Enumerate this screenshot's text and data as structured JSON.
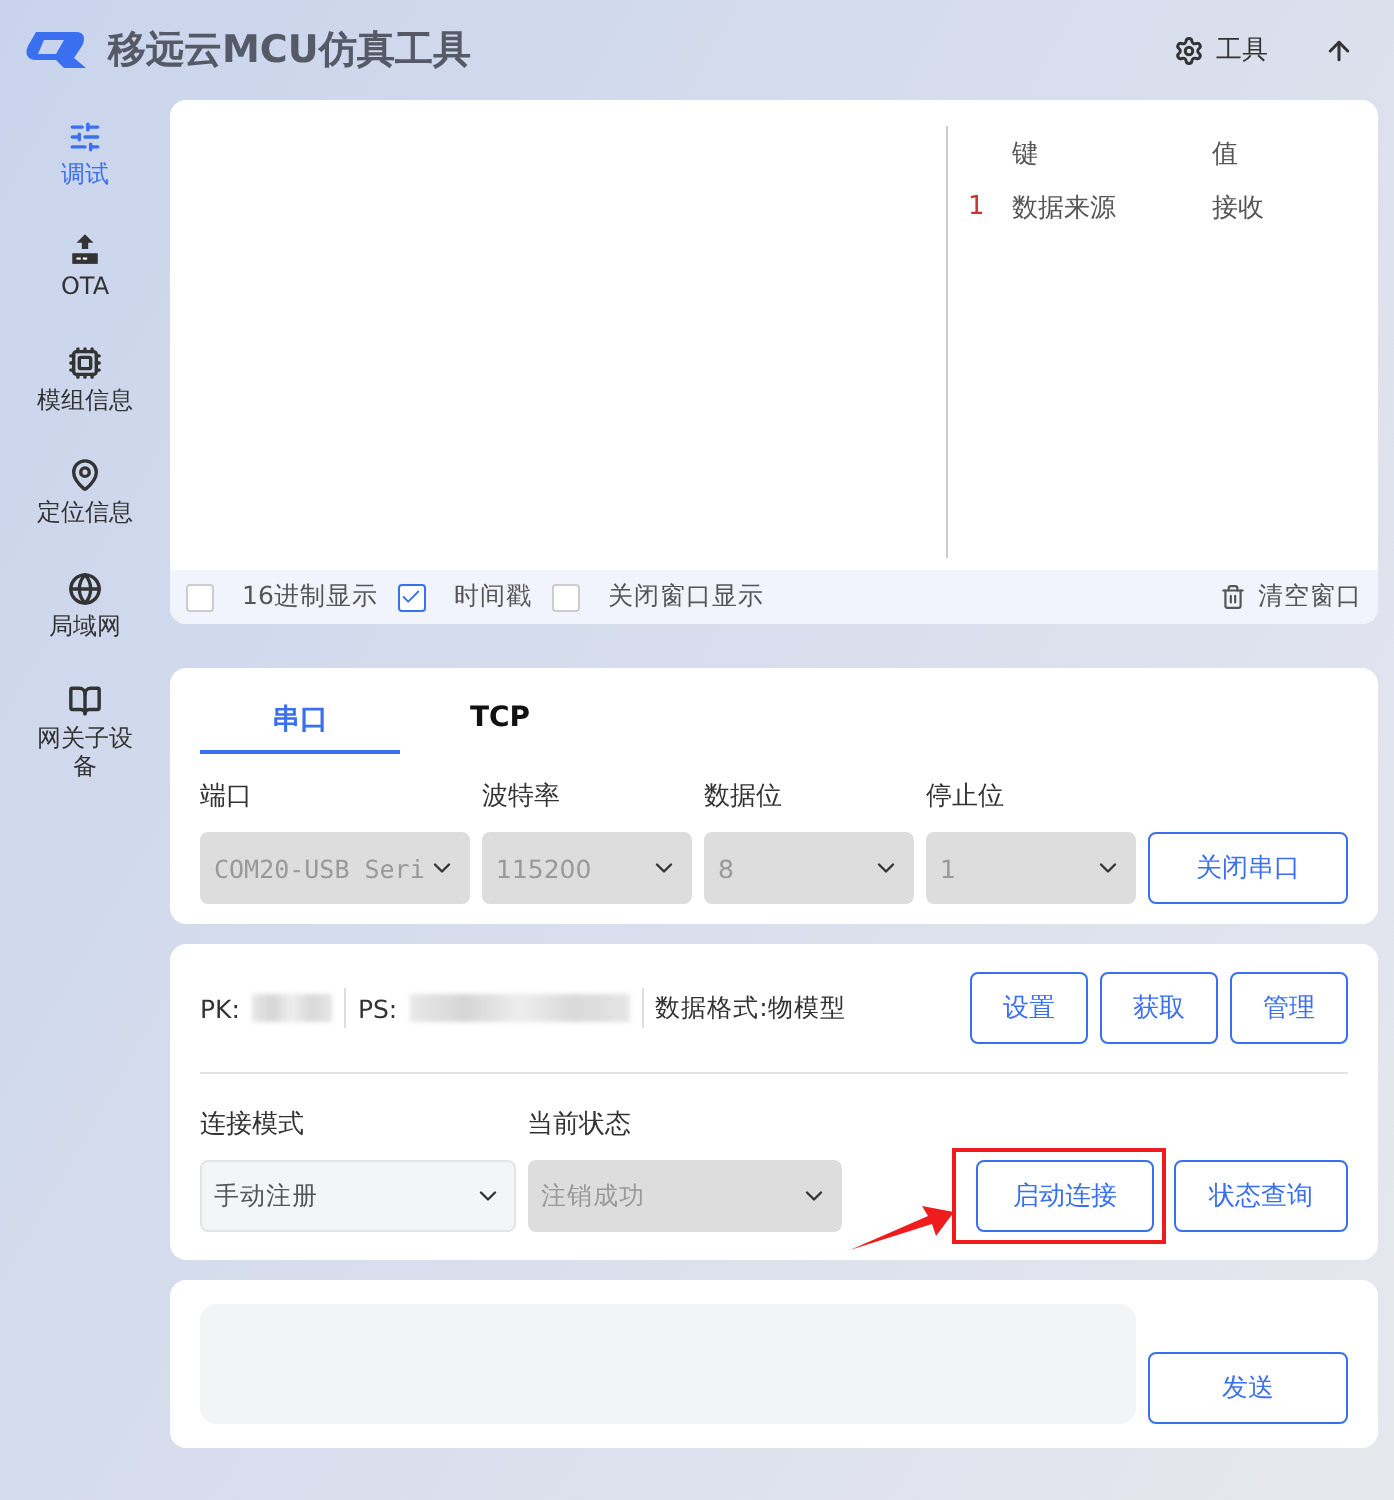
{
  "header": {
    "title": "移远云MCU仿真工具",
    "tools_button": "工具"
  },
  "sidebar": {
    "items": [
      {
        "label": "调试",
        "selected": true
      },
      {
        "label": "OTA",
        "selected": false
      },
      {
        "label": "模组信息",
        "selected": false
      },
      {
        "label": "定位信息",
        "selected": false
      },
      {
        "label": "局域网",
        "selected": false
      },
      {
        "label": "网关子设备",
        "selected": false
      }
    ]
  },
  "log_panel": {
    "table": {
      "columns": [
        "键",
        "值"
      ],
      "rows": [
        {
          "index": "1",
          "key": "数据来源",
          "value": "接收"
        }
      ]
    },
    "options": [
      {
        "label": "16进制显示",
        "checked": false
      },
      {
        "label": "时间戳",
        "checked": true
      },
      {
        "label": "关闭窗口显示",
        "checked": false
      }
    ],
    "clear_button": "清空窗口"
  },
  "serial_panel": {
    "tabs": [
      {
        "label": "串口",
        "selected": true
      },
      {
        "label": "TCP",
        "selected": false
      }
    ],
    "fields": [
      {
        "label": "端口",
        "value": "COM20-USB Seri",
        "disabled": true
      },
      {
        "label": "波特率",
        "value": "115200",
        "disabled": true
      },
      {
        "label": "数据位",
        "value": "8",
        "disabled": true
      },
      {
        "label": "停止位",
        "value": "1",
        "disabled": true
      }
    ],
    "button": "关闭串口"
  },
  "product_panel": {
    "pk_label": "PK:",
    "ps_label": "PS:",
    "format": "数据格式:物模型",
    "buttons": [
      "设置",
      "获取",
      "管理"
    ],
    "fields": [
      {
        "label": "连接模式",
        "value": "手动注册",
        "disabled": false
      },
      {
        "label": "当前状态",
        "value": "注销成功",
        "disabled": true
      }
    ],
    "actions": [
      {
        "label": "启动连接",
        "annotated": true
      },
      {
        "label": "状态查询",
        "annotated": false
      }
    ]
  },
  "send_panel": {
    "button": "发送"
  }
}
